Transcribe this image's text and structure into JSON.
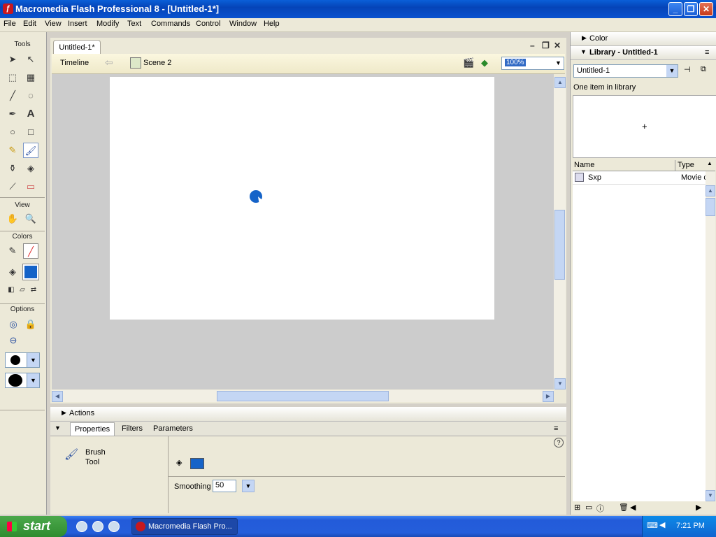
{
  "window": {
    "title": "Macromedia Flash Professional 8 - [Untitled-1*]"
  },
  "menu": [
    "File",
    "Edit",
    "View",
    "Insert",
    "Modify",
    "Text",
    "Commands",
    "Control",
    "Window",
    "Help"
  ],
  "tools": {
    "header": "Tools",
    "view_header": "View",
    "colors_header": "Colors",
    "options_header": "Options"
  },
  "document": {
    "tab": "Untitled-1*",
    "timeline_label": "Timeline",
    "scene": "Scene 2",
    "zoom": "100%"
  },
  "panels": {
    "actions": "Actions",
    "tabs": [
      "Properties",
      "Filters",
      "Parameters"
    ],
    "tool_name_line1": "Brush",
    "tool_name_line2": "Tool",
    "smoothing_label": "Smoothing",
    "smoothing_value": "50"
  },
  "right": {
    "color_header": "Color",
    "library_header": "Library - Untitled-1",
    "library_select": "Untitled-1",
    "library_count": "One item in library",
    "preview_plus": "+",
    "col_name": "Name",
    "col_type": "Type",
    "items": [
      {
        "name": "Sxp",
        "type": "Movie c"
      }
    ]
  },
  "taskbar": {
    "start": "start",
    "task": "Macromedia Flash Pro...",
    "time": "7:21 PM"
  },
  "colors": {
    "fill": "#1563c8",
    "titlebar": "#0a52cf"
  }
}
